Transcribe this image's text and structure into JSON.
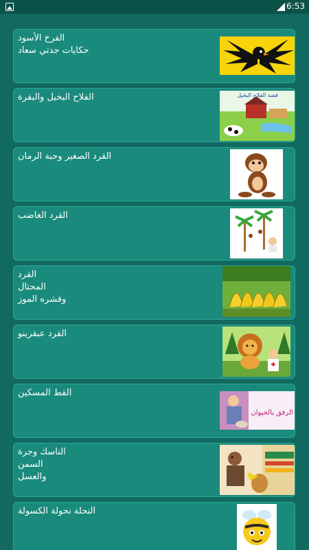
{
  "status_bar": {
    "time": "6:53",
    "left_icon": "gallery-icon",
    "right_icon": "signal-icon"
  },
  "stories": [
    {
      "title": "الفرخ الأسود\nحكايات جدتي سعاد",
      "image": "black-bird-image"
    },
    {
      "title": "الفلاح البخيل والبقرة",
      "image": "farm-cow-image",
      "image_caption": "قصة الفلاح البخيل"
    },
    {
      "title": "القرد الصغير وحبة الرمان",
      "image": "curious-monkey-image"
    },
    {
      "title": "القرد الغاضب",
      "image": "palm-trees-monkeys-image"
    },
    {
      "title": "القرد المحتال\nوقشره الموز",
      "image": "bananas-image"
    },
    {
      "title": "القرد عبقرينو",
      "image": "lion-doctor-image"
    },
    {
      "title": "القط المسكين",
      "image": "animal-kindness-image",
      "image_caption": "الرفق بالحيوان"
    },
    {
      "title": "الناسك وجرة السمن\nوالعسل",
      "image": "hermit-jar-image"
    },
    {
      "title": "النحلة نحولة الكسولة",
      "image": "lazy-bee-image"
    }
  ],
  "colors": {
    "background": "#11695f",
    "card": "#1a8a7c",
    "card_border": "#2aa796",
    "text": "#ffffff"
  }
}
